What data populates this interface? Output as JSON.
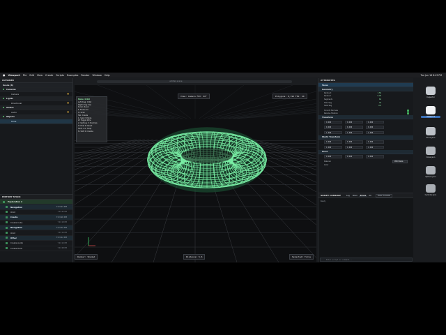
{
  "menubar": {
    "app_name": "Viewport",
    "items": [
      "File",
      "Edit",
      "View",
      "Create",
      "Scripts",
      "Examples",
      "Render",
      "Window",
      "Help"
    ],
    "clock": "Tue Jun 16  8:43 PM"
  },
  "outliner": {
    "title": "OUTLINER",
    "header_right": "",
    "rows": [
      {
        "label": "Scene (6)",
        "kind": "group",
        "badge": ""
      },
      {
        "label": "Cameras",
        "kind": "group",
        "badge": ""
      },
      {
        "label": "Camera",
        "kind": "sub",
        "badge": ""
      },
      {
        "label": "Lights",
        "kind": "group",
        "badge": ""
      },
      {
        "label": "Directional",
        "kind": "sub",
        "badge": ""
      },
      {
        "label": "Audios",
        "kind": "group",
        "badge": ""
      },
      {
        "label": "Audio",
        "kind": "sub",
        "badge": ""
      },
      {
        "label": "Objects",
        "kind": "group",
        "badge": ""
      },
      {
        "label": "Torus",
        "kind": "sub-selected",
        "badge": ""
      }
    ]
  },
  "history": {
    "title": "HISTORY STACK",
    "rows": [
      {
        "label": "Exploration 2",
        "kind": "head",
        "time": ""
      },
      {
        "label": "Navigation",
        "kind": "nav",
        "time": "7:43:24 PM"
      },
      {
        "label": "Orbit",
        "kind": "item",
        "time": "7:43:22 PM"
      },
      {
        "label": "Create",
        "kind": "nav",
        "time": "7:43:20 PM"
      },
      {
        "label": "Create Cube",
        "kind": "item",
        "time": "7:43:18 PM"
      },
      {
        "label": "Navigation",
        "kind": "nav",
        "time": "7:43:16 PM"
      },
      {
        "label": "Orbit",
        "kind": "item",
        "time": "7:43:14 PM"
      },
      {
        "label": "Other",
        "kind": "nav",
        "time": "7:43:12 PM"
      },
      {
        "label": "Create Audio",
        "kind": "item",
        "time": "7:43:10 PM"
      },
      {
        "label": "Create Helix",
        "kind": "item",
        "time": "7:43:08 PM"
      }
    ]
  },
  "viewport": {
    "url": "untitled.scene",
    "view_label": "View: Camera  FOV: 60°",
    "polygons": "Polygons: 8,192  FPS: 60",
    "render_mode": "Render: Shaded",
    "distance": "Distance: 5.6",
    "selected": "Selected: Torus",
    "shortcuts": {
      "title": "Mode: Orbit",
      "lines": [
        "Left drag: Orbit",
        "Right drag: Pan",
        "Scroll: Zoom",
        "F: Frame All",
        "G: Grab",
        "Tab: Create",
        "1: Solid 3 Mode",
        "W: Toggle Wire",
        "2: Vertices  3: Normals",
        "H: Hide  R: Reset",
        "Shift + G: Snap",
        "N: Shift  D: Delete"
      ]
    },
    "mesh_color": "#7af0a6",
    "background_color": "#0e0f11"
  },
  "attributes": {
    "title": "ATTRIBUTES",
    "header_right": "",
    "object_name": "Torus",
    "geometry_label": "Geometry",
    "geometry_lines": [
      {
        "label": "Radius X",
        "value": "1.50"
      },
      {
        "label": "Radius Y",
        "value": "0.45"
      },
      {
        "label": "Segments",
        "value": "64"
      },
      {
        "label": "Tube Seg",
        "value": "32"
      },
      {
        "label": "Twist Seg",
        "value": "0.0"
      }
    ],
    "shading_lines": [
      "Smooth Normals",
      "Receive Shadow"
    ],
    "sections": [
      {
        "label": "Transform",
        "values": [
          [
            "0.000",
            "0.000",
            "0.000"
          ],
          [
            "0.000",
            "0.000",
            "0.000"
          ],
          [
            "1.000",
            "1.000",
            "1.000"
          ]
        ]
      },
      {
        "label": "World Transform",
        "values": [
          [
            "0.000",
            "0.000",
            "0.000"
          ],
          [
            "1.000",
            "1.000",
            "1.000"
          ]
        ]
      },
      {
        "label": "Pivot",
        "values": [
          [
            "0.000",
            "0.000",
            "0.000"
          ]
        ]
      }
    ],
    "material_label": "Material",
    "material_select": "PBR Metal..",
    "color_label": "Color"
  },
  "console": {
    "title": "SCRIPT CONSOLE",
    "tabs": [
      "Log",
      "Warn",
      "Errors",
      "All"
    ],
    "active_tab": "Errors",
    "button": "Clear Console",
    "output": "Ready",
    "input_placeholder": "Enter script or command..."
  },
  "dock": {
    "items": [
      {
        "label": "Inspector",
        "color": "#c8cdd3",
        "active": false
      },
      {
        "label": "Viewport",
        "color": "#f2f4f6",
        "active": true
      },
      {
        "label": "Torus.json",
        "color": "#bdc2c8",
        "active": false
      },
      {
        "label": "Cube.json",
        "color": "#b1b6bc",
        "active": false
      },
      {
        "label": "Sphere.json",
        "color": "#aeb3b9",
        "active": false
      },
      {
        "label": "Cylinder.json",
        "color": "#a9aeb4",
        "active": false
      }
    ]
  }
}
